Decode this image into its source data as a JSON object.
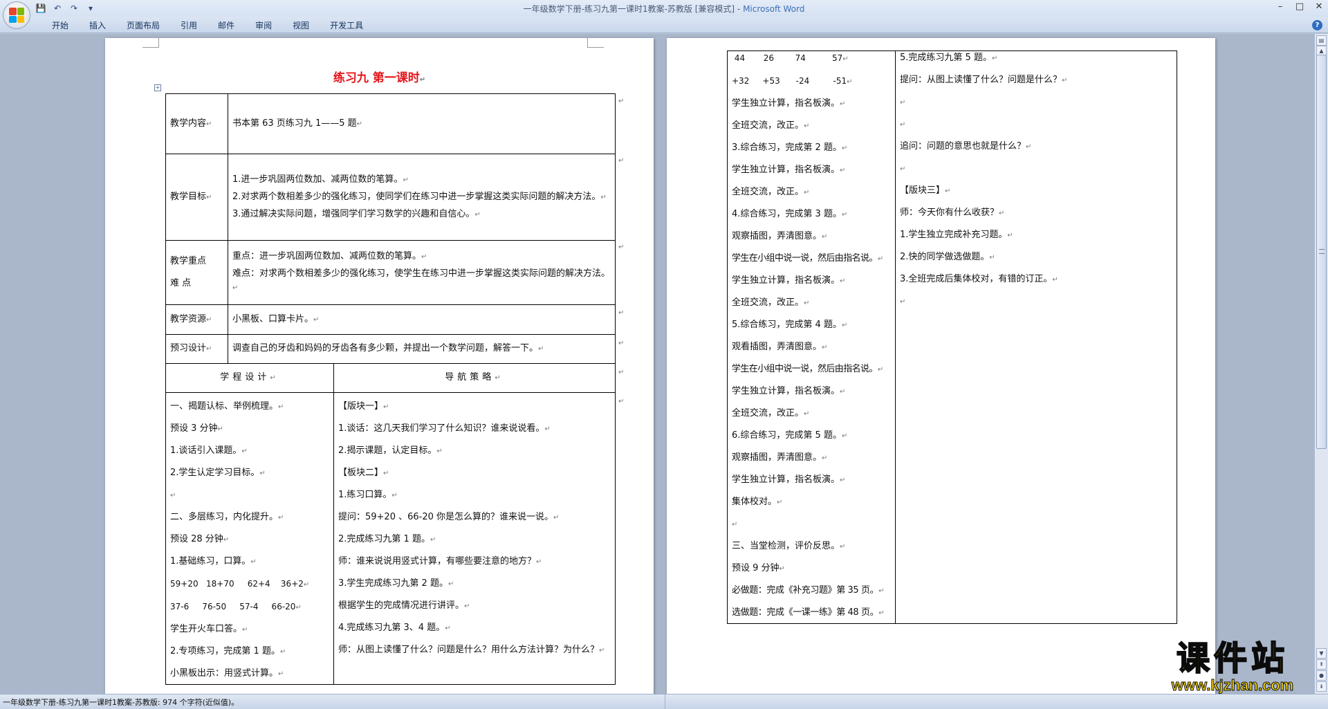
{
  "window": {
    "title_doc": "一年级数学下册-练习九第一课时1教案-苏教版 [兼容模式] - ",
    "title_app": "Microsoft Word"
  },
  "ribbon": {
    "tabs": [
      "开始",
      "插入",
      "页面布局",
      "引用",
      "邮件",
      "审阅",
      "视图",
      "开发工具"
    ]
  },
  "page1": {
    "title": "练习九  第一课时",
    "info_rows": [
      {
        "label": "教学内容",
        "paras": [
          "书本第 63 页练习九 1——5 题"
        ]
      },
      {
        "label": "教学目标",
        "paras": [
          "  1.进一步巩固两位数加、减两位数的笔算。",
          "  2.对求两个数相差多少的强化练习，使同学们在练习中进一步掌握这类实际问题的解决方法。",
          "  3.通过解决实际问题，增强同学们学习数学的兴趣和自信心。"
        ]
      },
      {
        "label": "教学重点\n难    点",
        "paras": [
          "重点：进一步巩固两位数加、减两位数的笔算。",
          "难点：对求两个数相差多少的强化练习，使学生在练习中进一步掌握这类实际问题的解决方法。"
        ]
      },
      {
        "label": "教学资源",
        "paras": [
          "小黑板、口算卡片。"
        ]
      },
      {
        "label": "预习设计",
        "paras": [
          "调查自己的牙齿和妈妈的牙齿各有多少颗，并提出一个数学问题，解答一下。"
        ]
      }
    ],
    "headers": [
      "学程设计",
      "导航策略"
    ],
    "left_col": [
      "一、揭题认标、举例梳理。",
      "预设 3 分钟",
      "1.谈话引入课题。",
      "2.学生认定学习目标。",
      "",
      "二、多层练习，内化提升。",
      "预设 28 分钟",
      "1.基础练习，口算。",
      "59+20   18+70     62+4    36+2",
      "37-6     76-50     57-4     66-20",
      "学生开火车口答。",
      "2.专项练习，完成第 1 题。",
      "小黑板出示：用竖式计算。"
    ],
    "right_col": [
      "【版块一】",
      "1.谈话：这几天我们学习了什么知识？谁来说说看。",
      "2.揭示课题，认定目标。",
      "【板块二】",
      "1.练习口算。",
      "提问：59+20 、66-20 你是怎么算的？谁来说一说。",
      "2.完成练习九第 1 题。",
      "师：谁来说说用竖式计算，有哪些要注意的地方？",
      "3.学生完成练习九第 2 题。",
      "根据学生的完成情况进行讲评。",
      "4.完成练习九第 3、4 题。",
      "师：从图上读懂了什么？问题是什么？用什么方法计算？为什么？"
    ]
  },
  "page2": {
    "left_col": [
      " 44       26        74          57",
      "+32     +53      -24         -51",
      "学生独立计算，指名板演。",
      "全班交流，改正。",
      "3.综合练习，完成第 2 题。",
      "学生独立计算，指名板演。",
      "全班交流，改正。",
      "4.综合练习，完成第 3 题。",
      "观察插图，弄清图意。",
      "学生在小组中说一说，然后由指名说。",
      "学生独立计算，指名板演。",
      "全班交流，改正。",
      "5.综合练习，完成第 4 题。",
      "观看插图，弄清图意。",
      "学生在小组中说一说，然后由指名说。",
      "学生独立计算，指名板演。",
      "全班交流，改正。",
      "6.综合练习，完成第 5 题。",
      "观察插图，弄清图意。",
      "学生独立计算，指名板演。",
      "集体校对。",
      "",
      "三、当堂检测，评价反思。",
      "预设 9 分钟",
      "必做题：完成《补充习题》第 35 页。",
      "选做题：完成《一课一练》第 48 页。"
    ],
    "right_col": [
      "5.完成练习九第 5 题。",
      "提问：从图上读懂了什么？问题是什么？",
      "",
      "",
      "追问：问题的意思也就是什么？",
      "",
      "【版块三】",
      "师：今天你有什么收获？",
      "1.学生独立完成补充习题。",
      "2.快的同学做选做题。",
      "3.全班完成后集体校对，有错的订正。",
      ""
    ]
  },
  "status": {
    "text": "一年级数学下册-练习九第一课时1教案-苏教版: 974 个字符(近似值)。"
  },
  "watermark": {
    "cn": "课件站",
    "url": "www.kjzhan.com"
  },
  "colors": {
    "title_red": "#e3161b",
    "watermark_yellow": "#f4d30f"
  }
}
